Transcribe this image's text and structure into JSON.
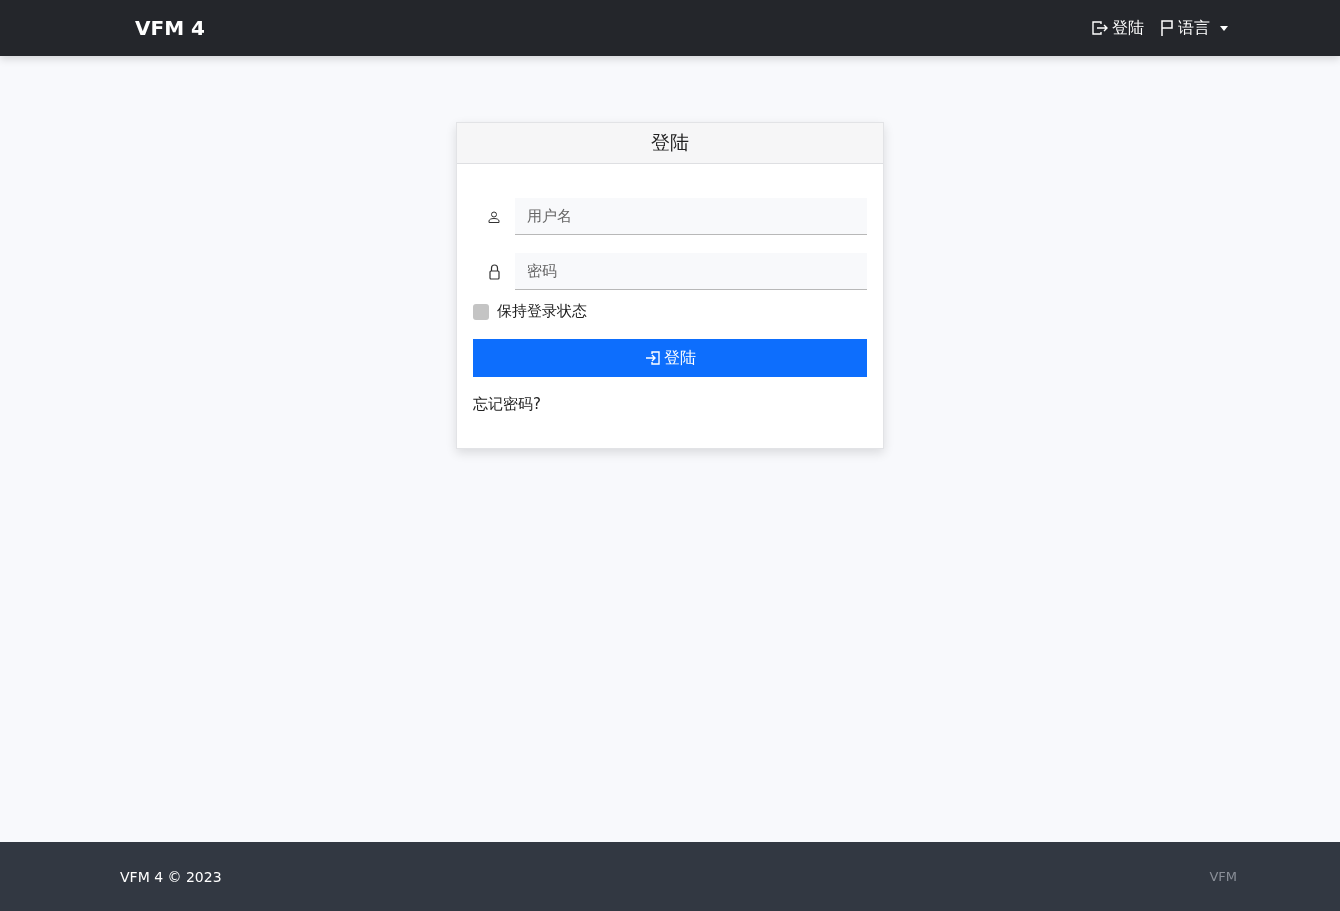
{
  "navbar": {
    "brand": "VFM 4",
    "login_link": "登陆",
    "language_menu": {
      "label": "语言",
      "expanded": false
    }
  },
  "login_card": {
    "title": "登陆",
    "username": {
      "placeholder": "用户名"
    },
    "password": {
      "placeholder": "密码"
    },
    "remember": {
      "label": "保持登录状态",
      "checked": false
    },
    "submit": "登陆",
    "forgot_link": "忘记密码?"
  },
  "footer": {
    "copyright": "VFM 4 © 2023",
    "right_text": "VFM"
  }
}
